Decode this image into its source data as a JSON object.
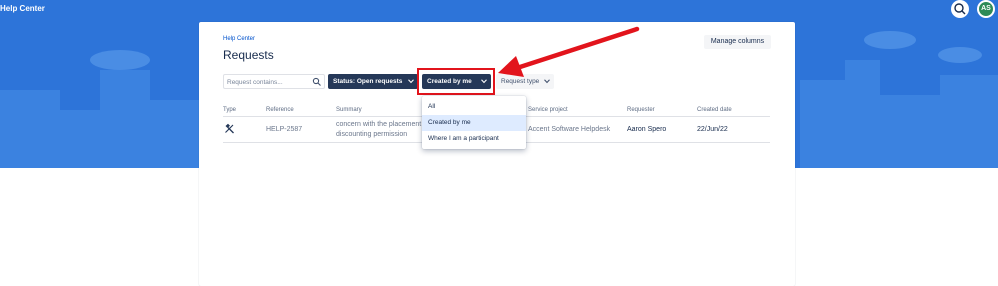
{
  "app": {
    "brand": "Help Center",
    "avatar_initials": "AS"
  },
  "page": {
    "breadcrumb": "Help Center",
    "title": "Requests",
    "manage_columns": "Manage columns"
  },
  "filters": {
    "search_placeholder": "Request contains...",
    "status_label": "Status: Open requests",
    "created_label": "Created by me",
    "request_type_label": "Request type"
  },
  "dropdown": {
    "items": [
      "All",
      "Created by me",
      "Where I am a participant"
    ],
    "selected": "Created by me"
  },
  "table": {
    "headers": {
      "type": "Type",
      "reference": "Reference",
      "summary": "Summary",
      "service_project": "Service project",
      "requester": "Requester",
      "created_date": "Created date"
    },
    "rows": [
      {
        "reference": "HELP-2587",
        "summary_line1": "concern with the placement",
        "summary_line2": "discounting permission",
        "service_project": "Accent Software Helpdesk",
        "requester": "Aaron Spero",
        "created_date": "22/Jun/22"
      }
    ]
  },
  "colors": {
    "hero_blue": "#2d74d9",
    "navy_chip": "#253858",
    "annotation_red": "#e2141c",
    "menu_selected": "#deebff"
  },
  "icons": [
    "search-icon",
    "chevron-down-icon",
    "request-type-icon"
  ]
}
